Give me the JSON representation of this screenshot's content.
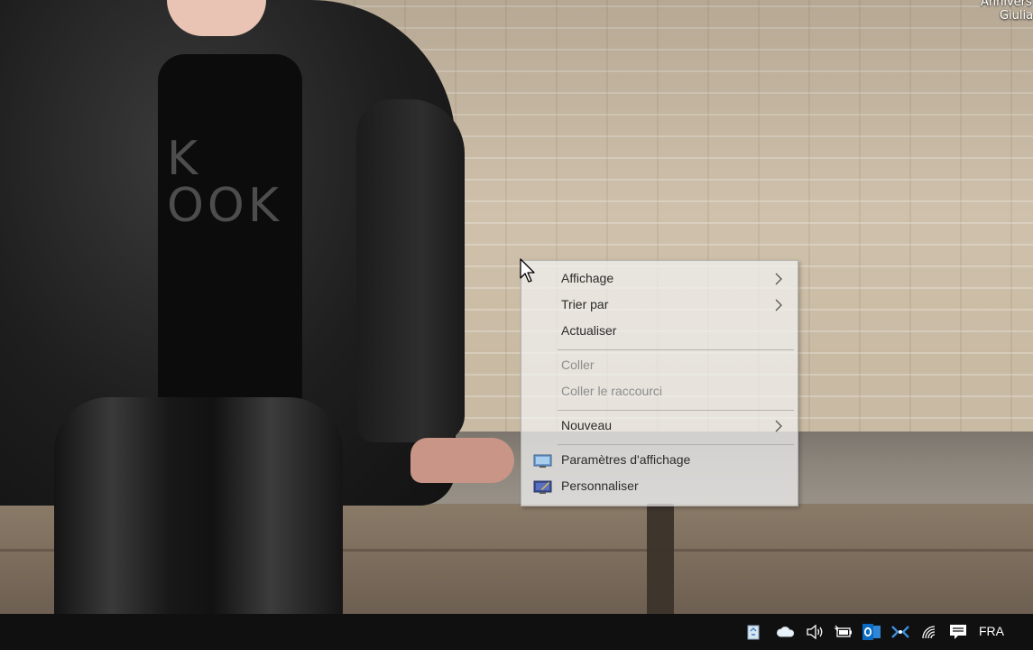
{
  "desktop": {
    "icon_labels": [
      "Annivers",
      "Giulia"
    ],
    "shirt_print": "K\nOOK"
  },
  "context_menu": {
    "items": [
      {
        "label": "Affichage",
        "submenu": true,
        "enabled": true
      },
      {
        "label": "Trier par",
        "submenu": true,
        "enabled": true
      },
      {
        "label": "Actualiser",
        "submenu": false,
        "enabled": true
      },
      {
        "label": "Coller",
        "submenu": false,
        "enabled": false
      },
      {
        "label": "Coller le raccourci",
        "submenu": false,
        "enabled": false
      },
      {
        "label": "Nouveau",
        "submenu": true,
        "enabled": true
      },
      {
        "label": "Paramètres d'affichage",
        "submenu": false,
        "enabled": true,
        "icon": "display-settings-icon"
      },
      {
        "label": "Personnaliser",
        "submenu": false,
        "enabled": true,
        "icon": "personalize-icon"
      }
    ]
  },
  "taskbar": {
    "tray_icons": [
      "recycle-bin-icon",
      "onedrive-cloud-icon",
      "volume-icon",
      "battery-icon",
      "outlook-icon",
      "network-share-icon",
      "wifi-icon",
      "action-center-icon"
    ],
    "language": "FRA"
  },
  "colors": {
    "taskbar": "#101010",
    "menu_bg": "#f2f2f2",
    "menu_text": "#2b2b2b",
    "menu_disabled_text": "#8d8d8d",
    "outlook_blue": "#0a6ac2"
  }
}
